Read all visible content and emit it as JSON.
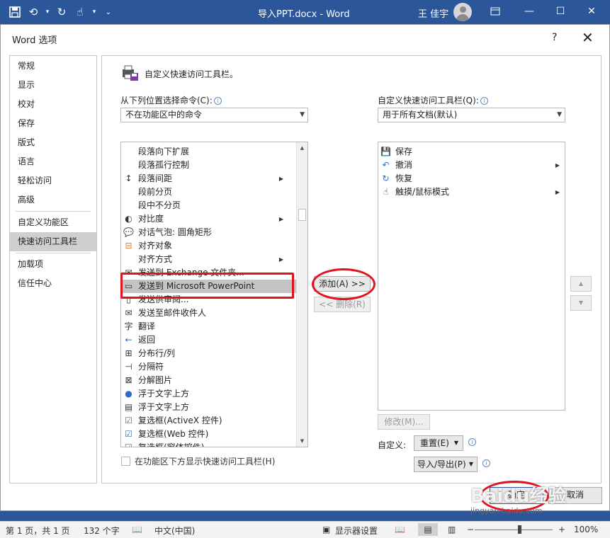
{
  "app": {
    "doc_title": "导入PPT.docx  -  Word",
    "user": "王 佳宇"
  },
  "dialog": {
    "title": "Word 选项",
    "help": "?",
    "close": "✕"
  },
  "nav": {
    "items": [
      {
        "label": "常规"
      },
      {
        "label": "显示"
      },
      {
        "label": "校对"
      },
      {
        "label": "保存"
      },
      {
        "label": "版式"
      },
      {
        "label": "语言"
      },
      {
        "label": "轻松访问"
      },
      {
        "label": "高级"
      },
      {
        "label": "自定义功能区"
      },
      {
        "label": "快速访问工具栏"
      },
      {
        "label": "加载项"
      },
      {
        "label": "信任中心"
      }
    ],
    "selected": "快速访问工具栏"
  },
  "pane": {
    "heading": "自定义快速访问工具栏。",
    "choose_label": "从下列位置选择命令(C):",
    "choose_value": "不在功能区中的命令",
    "customize_label": "自定义快速访问工具栏(Q):",
    "customize_value": "用于所有文档(默认)",
    "commands": [
      {
        "label": "段落向下扩展",
        "icon": "blank",
        "submenu": false
      },
      {
        "label": "段落孤行控制",
        "icon": "blank",
        "submenu": false
      },
      {
        "label": "段落间距",
        "icon": "paragraph-spacing-icon",
        "submenu": true
      },
      {
        "label": "段前分页",
        "icon": "blank",
        "submenu": false
      },
      {
        "label": "段中不分页",
        "icon": "blank",
        "submenu": false
      },
      {
        "label": "对比度",
        "icon": "contrast-icon",
        "submenu": true
      },
      {
        "label": "对话气泡: 圆角矩形",
        "icon": "speech-bubble-icon",
        "submenu": false
      },
      {
        "label": "对齐对象",
        "icon": "align-objects-icon",
        "submenu": false
      },
      {
        "label": "对齐方式",
        "icon": "blank",
        "submenu": true
      },
      {
        "label": "发送到 Exchange 文件夹...",
        "icon": "send-exchange-icon",
        "submenu": false
      },
      {
        "label": "发送到 Microsoft PowerPoint",
        "icon": "send-ppt-icon",
        "submenu": false,
        "highlighted": true
      },
      {
        "label": "发送供审阅...",
        "icon": "send-review-icon",
        "submenu": false
      },
      {
        "label": "发送至邮件收件人",
        "icon": "mail-recipient-icon",
        "submenu": false
      },
      {
        "label": "翻译",
        "icon": "translate-icon",
        "submenu": false
      },
      {
        "label": "返回",
        "icon": "back-arrow-icon",
        "submenu": false
      },
      {
        "label": "分布行/列",
        "icon": "distribute-icon",
        "submenu": false
      },
      {
        "label": "分隔符",
        "icon": "separator-icon",
        "submenu": false
      },
      {
        "label": "分解图片",
        "icon": "ungroup-picture-icon",
        "submenu": false
      },
      {
        "label": "浮于文字上方",
        "icon": "float-above-icon",
        "submenu": false
      },
      {
        "label": "浮于文字上方",
        "icon": "float-above-icon-2",
        "submenu": false
      },
      {
        "label": "复选框(ActiveX 控件)",
        "icon": "checkbox-icon",
        "submenu": false
      },
      {
        "label": "复选框(Web 控件)",
        "icon": "checkbox-icon",
        "submenu": false
      },
      {
        "label": "复选框(窗体控件)",
        "icon": "checkbox-icon",
        "submenu": false
      }
    ],
    "toolbar_items": [
      {
        "label": "保存",
        "icon": "save-icon",
        "submenu": false
      },
      {
        "label": "撤消",
        "icon": "undo-icon",
        "submenu": true
      },
      {
        "label": "恢复",
        "icon": "redo-icon",
        "submenu": false
      },
      {
        "label": "触摸/鼠标模式",
        "icon": "touch-icon",
        "submenu": true
      }
    ],
    "add_button": "添加(A) >>",
    "remove_button": "<< 删除(R)",
    "modify_button": "修改(M)...",
    "customize_label2": "自定义:",
    "reset_button": "重置(E)",
    "import_export_button": "导入/导出(P)",
    "show_below_ribbon": "在功能区下方显示快速访问工具栏(H)"
  },
  "footer": {
    "ok": "确定",
    "cancel": "取消"
  },
  "status": {
    "page": "第 1 页，共 1 页",
    "words": "132 个字",
    "language": "中文(中国)",
    "display_settings": "显示器设置",
    "zoom": "100%"
  },
  "watermark": {
    "text": "Baidu经验",
    "url": "jingyan.baidu.com"
  },
  "colors": {
    "title_bar": "#2b579a",
    "highlight": "#e0141e"
  }
}
